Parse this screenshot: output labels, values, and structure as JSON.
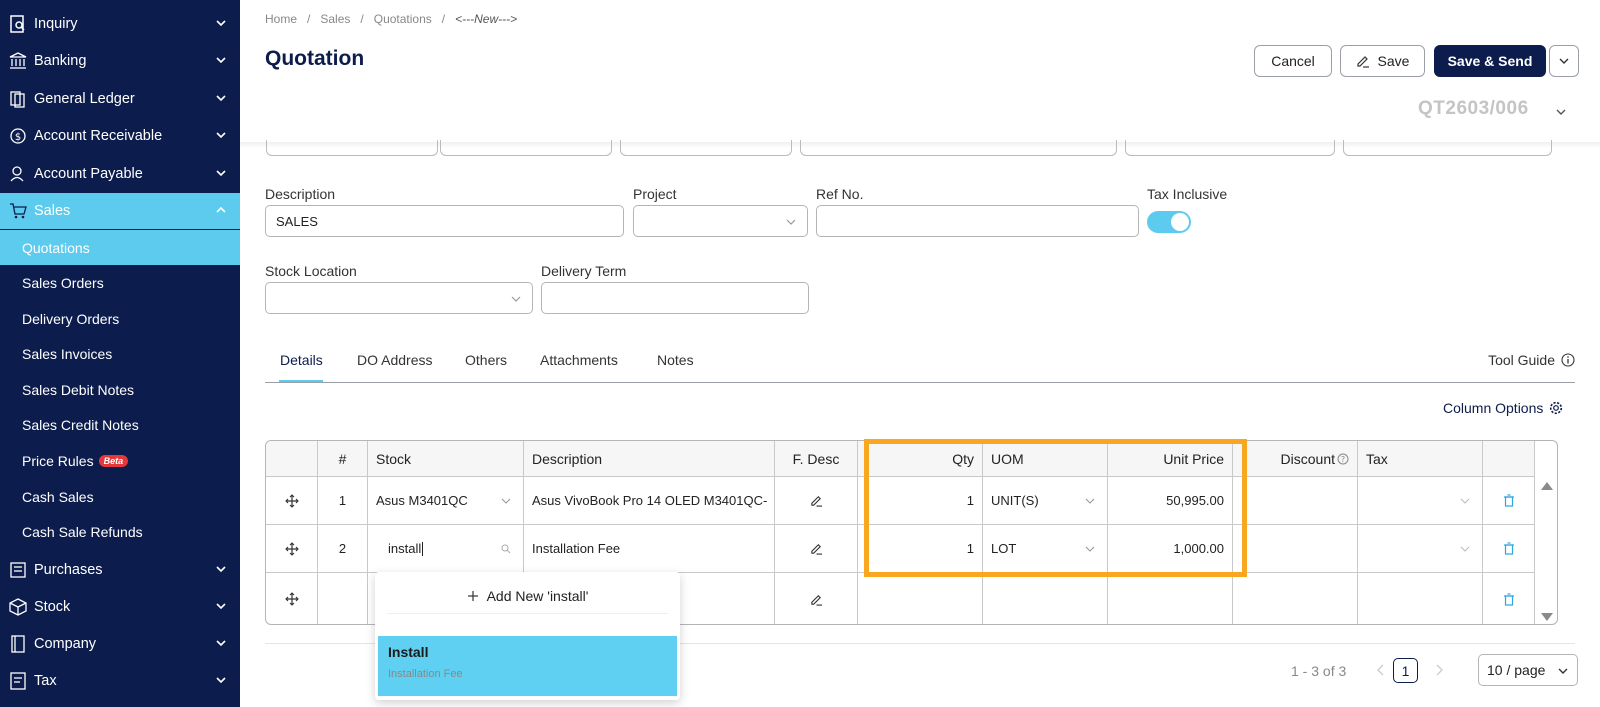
{
  "sidebar": {
    "items": [
      {
        "label": "Inquiry",
        "icon": "inquiry-icon"
      },
      {
        "label": "Banking",
        "icon": "bank-icon"
      },
      {
        "label": "General Ledger",
        "icon": "ledger-icon"
      },
      {
        "label": "Account Receivable",
        "icon": "receivable-icon"
      },
      {
        "label": "Account Payable",
        "icon": "payable-icon"
      },
      {
        "label": "Sales",
        "icon": "cart-icon"
      },
      {
        "label": "Purchases",
        "icon": "purchases-icon"
      },
      {
        "label": "Stock",
        "icon": "box-icon"
      },
      {
        "label": "Company",
        "icon": "company-icon"
      },
      {
        "label": "Tax",
        "icon": "tax-icon"
      }
    ],
    "sales_sub": [
      "Quotations",
      "Sales Orders",
      "Delivery Orders",
      "Sales Invoices",
      "Sales Debit Notes",
      "Sales Credit Notes",
      "Price Rules",
      "Cash Sales",
      "Cash Sale Refunds"
    ],
    "beta_label": "Beta"
  },
  "breadcrumb": [
    "Home",
    "Sales",
    "Quotations",
    "<---New--->"
  ],
  "title": "Quotation",
  "buttons": {
    "cancel": "Cancel",
    "save": "Save",
    "save_send": "Save & Send"
  },
  "doc_no": "QT2603/006",
  "form": {
    "description_label": "Description",
    "description_value": "SALES",
    "project_label": "Project",
    "project_value": "",
    "ref_label": "Ref No.",
    "ref_value": "",
    "tax_inclusive_label": "Tax Inclusive",
    "tax_inclusive_on": true,
    "stock_location_label": "Stock Location",
    "stock_location_value": "",
    "delivery_term_label": "Delivery Term",
    "delivery_term_value": ""
  },
  "tabs": [
    "Details",
    "DO Address",
    "Others",
    "Attachments",
    "Notes"
  ],
  "active_tab": "Details",
  "tool_guide": "Tool Guide",
  "column_options": "Column Options",
  "table": {
    "headers": [
      "#",
      "Stock",
      "Description",
      "F. Desc",
      "Qty",
      "UOM",
      "Unit Price",
      "Discount",
      "Tax"
    ],
    "rows": [
      {
        "no": "1",
        "stock": "Asus M3401QC",
        "description": "Asus VivoBook Pro 14 OLED M3401QC-",
        "qty": "1",
        "uom": "UNIT(S)",
        "unit_price": "50,995.00",
        "discount": "",
        "tax": ""
      },
      {
        "no": "2",
        "stock": "install",
        "description": "Installation Fee",
        "qty": "1",
        "uom": "LOT",
        "unit_price": "1,000.00",
        "discount": "",
        "tax": ""
      },
      {
        "no": "",
        "stock": "",
        "description": "",
        "qty": "",
        "uom": "",
        "unit_price": "",
        "discount": "",
        "tax": ""
      }
    ]
  },
  "popup": {
    "add_new": "Add New 'install'",
    "option_title": "Install",
    "option_sub": "Installation Fee"
  },
  "pager": {
    "range": "1 - 3 of 3",
    "page": "1",
    "size": "10 / page"
  },
  "colors": {
    "sidebar": "#0c1c4c",
    "accent": "#5ccbee",
    "highlight": "#f9a620"
  }
}
